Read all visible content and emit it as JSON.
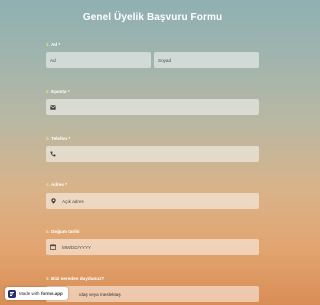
{
  "form": {
    "title": "Genel Üyelik Başvuru Formu",
    "q1": {
      "num": "1.",
      "label": "Ad",
      "req": " *",
      "first_placeholder": "Ad",
      "last_placeholder": "Soyad"
    },
    "q2": {
      "num": "2.",
      "label": "Eposta",
      "req": " *"
    },
    "q3": {
      "num": "3.",
      "label": "Telefon",
      "req": " *"
    },
    "q4": {
      "num": "4.",
      "label": "Adres",
      "req": " *",
      "placeholder": "Açık adres"
    },
    "q5": {
      "num": "5.",
      "label": "Doğum tarihi",
      "placeholder": "MM/DD/YYYY"
    },
    "q6": {
      "num": "6.",
      "label": "Bizi nereden duydunuz?",
      "placeholder": "ıdaş veya meslektaş"
    }
  },
  "badge": {
    "text": "Made with",
    "brand": "forms.app"
  },
  "colors": {
    "number_accent": "#f2e27c",
    "label": "#ffffff",
    "field_bg": "rgba(255,255,255,0.5)"
  },
  "icons": [
    "email-icon",
    "phone-icon",
    "location-pin-icon",
    "calendar-icon"
  ]
}
